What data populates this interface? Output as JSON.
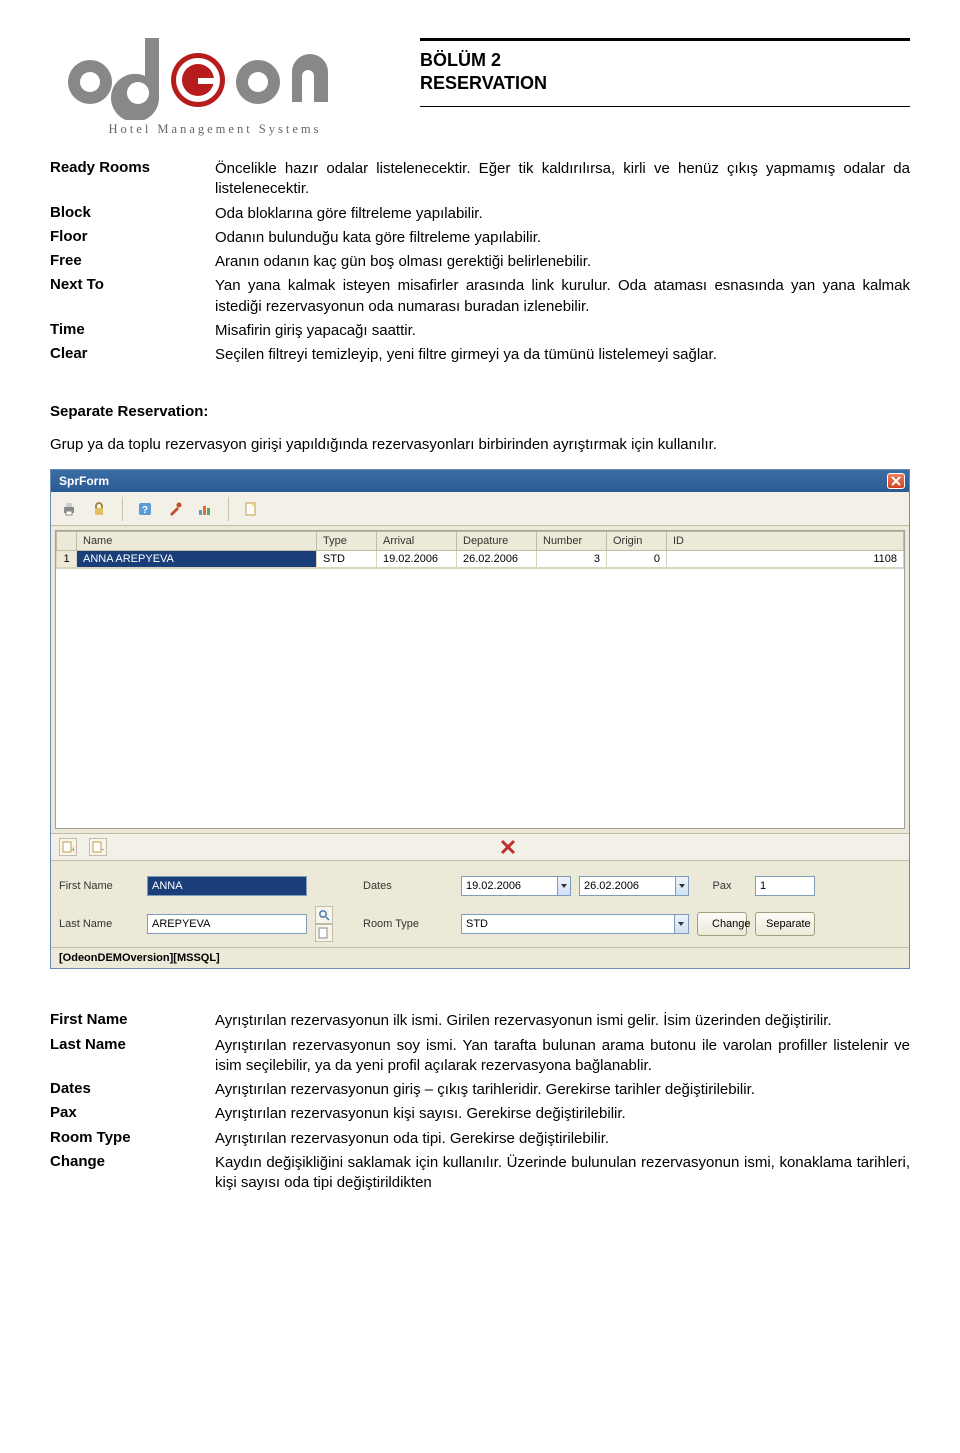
{
  "header": {
    "logo_tagline": "Hotel Management Systems",
    "section_line1": "BÖLÜM 2",
    "section_line2": "RESERVATION"
  },
  "defs1": [
    {
      "term": "Ready Rooms",
      "desc": "Öncelikle hazır odalar listelenecektir. Eğer tik kaldırılırsa, kirli ve henüz çıkış yapmamış odalar da listelenecektir."
    },
    {
      "term": "Block",
      "desc": "Oda bloklarına göre filtreleme yapılabilir."
    },
    {
      "term": "Floor",
      "desc": "Odanın bulunduğu kata göre filtreleme yapılabilir."
    },
    {
      "term": "Free",
      "desc": "Aranın odanın kaç gün boş olması gerektiği belirlenebilir."
    },
    {
      "term": "Next To",
      "desc": "Yan yana kalmak isteyen misafirler arasında link kurulur. Oda ataması esnasında yan yana kalmak istediği rezervasyonun oda numarası buradan izlenebilir."
    },
    {
      "term": "Time",
      "desc": "Misafirin giriş yapacağı saattir."
    },
    {
      "term": "Clear",
      "desc": "Seçilen filtreyi temizleyip, yeni filtre girmeyi ya da tümünü listelemeyi sağlar."
    }
  ],
  "subhead": "Separate Reservation:",
  "para1": "Grup ya da  toplu rezervasyon girişi yapıldığında rezervasyonları birbirinden ayrıştırmak için kullanılır.",
  "app": {
    "title": "SprForm",
    "grid": {
      "headers": [
        "",
        "Name",
        "Type",
        "Arrival",
        "Depature",
        "Number",
        "Origin",
        "ID"
      ],
      "rows": [
        {
          "num": "1",
          "name": "ANNA AREPYEVA",
          "type": "STD",
          "arrival": "19.02.2006",
          "departure": "26.02.2006",
          "number": "3",
          "origin": "0",
          "id": "1108"
        }
      ]
    },
    "form": {
      "first_name_label": "First Name",
      "first_name_value": "ANNA",
      "last_name_label": "Last Name",
      "last_name_value": "AREPYEVA",
      "dates_label": "Dates",
      "date1_value": "19.02.2006",
      "date2_value": "26.02.2006",
      "pax_label": "Pax",
      "pax_value": "1",
      "room_type_label": "Room Type",
      "room_type_value": "STD",
      "change_label": "Change",
      "separate_label": "Separate"
    },
    "status": "[OdeonDEMOversion][MSSQL]"
  },
  "defs2": [
    {
      "term": "First Name",
      "desc": "Ayrıştırılan rezervasyonun ilk ismi. Girilen rezervasyonun ismi gelir. İsim üzerinden değiştirilir."
    },
    {
      "term": "Last Name",
      "desc": "Ayrıştırılan rezervasyonun soy ismi. Yan tarafta bulunan arama butonu  ile varolan profiller listelenir ve isim seçilebilir, ya da  yeni profil açılarak rezervasyona bağlanablir."
    },
    {
      "term": "Dates",
      "desc": "Ayrıştırılan rezervasyonun giriş – çıkış tarihleridir. Gerekirse tarihler değiştirilebilir."
    },
    {
      "term": "Pax",
      "desc": "Ayrıştırılan rezervasyonun kişi sayısı. Gerekirse değiştirilebilir."
    },
    {
      "term": "Room Type",
      "desc": "Ayrıştırılan rezervasyonun oda tipi. Gerekirse değiştirilebilir."
    },
    {
      "term": "Change",
      "desc": "Kaydın değişikliğini saklamak için kullanılır. Üzerinde bulunulan rezervasyonun ismi, konaklama tarihleri, kişi sayısı oda tipi değiştirildikten"
    }
  ]
}
